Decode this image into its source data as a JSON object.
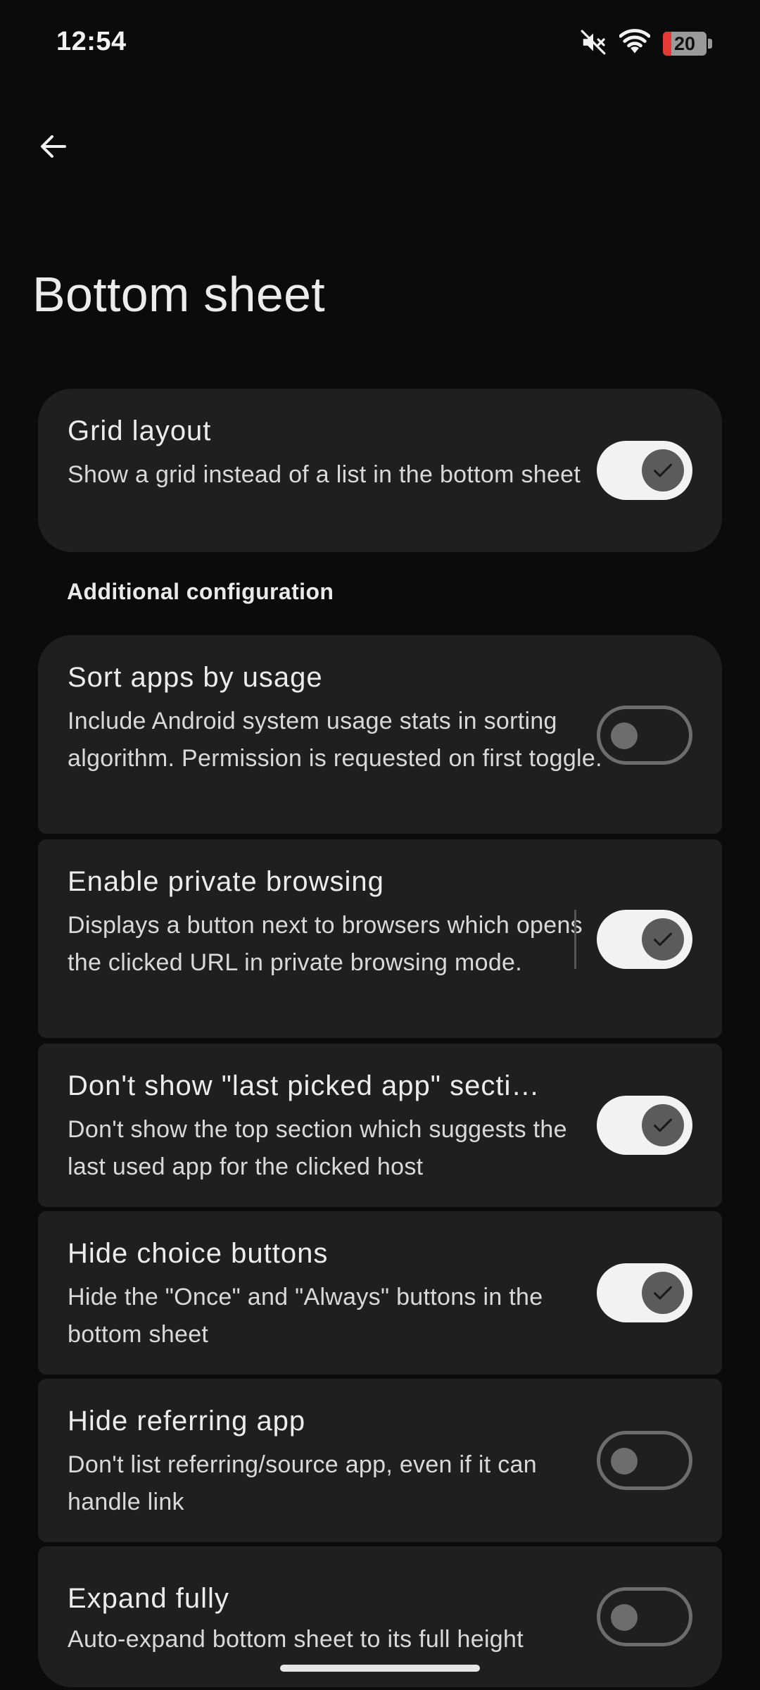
{
  "status_bar": {
    "time": "12:54",
    "battery_level": "20",
    "icons": [
      "mute-icon",
      "wifi-icon",
      "battery-icon"
    ]
  },
  "app_bar": {
    "back_icon": "arrow-left-icon",
    "title": "Bottom sheet"
  },
  "grid_layout": {
    "title": "Grid layout",
    "description": "Show a grid instead of a list in the bottom sheet",
    "enabled": true
  },
  "section_header": "Additional configuration",
  "settings": [
    {
      "title": "Sort apps by usage",
      "description": "Include Android system usage stats in sorting algorithm. Permission is requested on first toggle.",
      "enabled": false
    },
    {
      "title": "Enable private browsing",
      "description": "Displays a button next to browsers which opens the clicked URL in private browsing mode.",
      "enabled": true
    },
    {
      "title": "Don't show \"last picked app\" secti…",
      "description": "Don't show the top section which suggests the last used app for the clicked host",
      "enabled": true
    },
    {
      "title": "Hide choice buttons",
      "description": "Hide the \"Once\" and \"Always\" buttons in the bottom sheet",
      "enabled": true
    },
    {
      "title": "Hide referring app",
      "description": "Don't list referring/source app, even if it can handle link",
      "enabled": false
    },
    {
      "title": "Expand fully",
      "description": "Auto-expand bottom sheet to its full height",
      "enabled": false
    }
  ],
  "colors": {
    "background": "#0b0b0c",
    "card": "#1f1f20",
    "switch_on_track": "#f2f2f2",
    "switch_on_thumb": "#5b5b5c",
    "switch_off": "#6d6d6d",
    "battery_low": "#e53935"
  }
}
